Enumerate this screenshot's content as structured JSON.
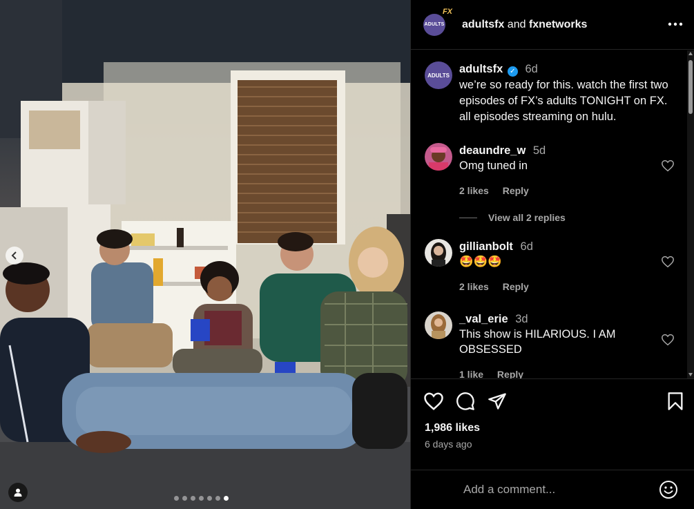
{
  "header": {
    "account1": "adultsfx",
    "connector": "and",
    "account2": "fxnetworks",
    "avatar_text": "ADULTS",
    "avatar_badge": "FX",
    "more_icon": "more-horizontal-icon"
  },
  "caption": {
    "username": "adultsfx",
    "time": "6d",
    "avatar_text": "ADULTS",
    "text": "we’re so ready for this. watch the first two episodes of FX’s adults TONIGHT on FX. all episodes streaming on hulu."
  },
  "comments": [
    {
      "username": "deaundre_w",
      "time": "5d",
      "text": "Omg tuned in",
      "likes": "2 likes",
      "reply": "Reply"
    },
    {
      "username": "gillianbolt",
      "time": "6d",
      "text": "🤩🤩🤩",
      "likes": "2 likes",
      "reply": "Reply"
    },
    {
      "username": "_val_erie",
      "time": "3d",
      "text": "This show is HILARIOUS. I AM OBSESSED",
      "likes": "1 like",
      "reply": "Reply"
    }
  ],
  "view_replies": "View all 2 replies",
  "actions": {
    "likes": "1,986 likes",
    "ago": "6 days ago"
  },
  "add_comment": {
    "placeholder": "Add a comment..."
  },
  "carousel": {
    "total": 7,
    "active_index": 6
  },
  "colors": {
    "background": "#000000",
    "text": "#f5f5f5",
    "muted": "#a8a8a8",
    "verified": "#1d9bf0",
    "adults_purple": "#5a4d98"
  }
}
